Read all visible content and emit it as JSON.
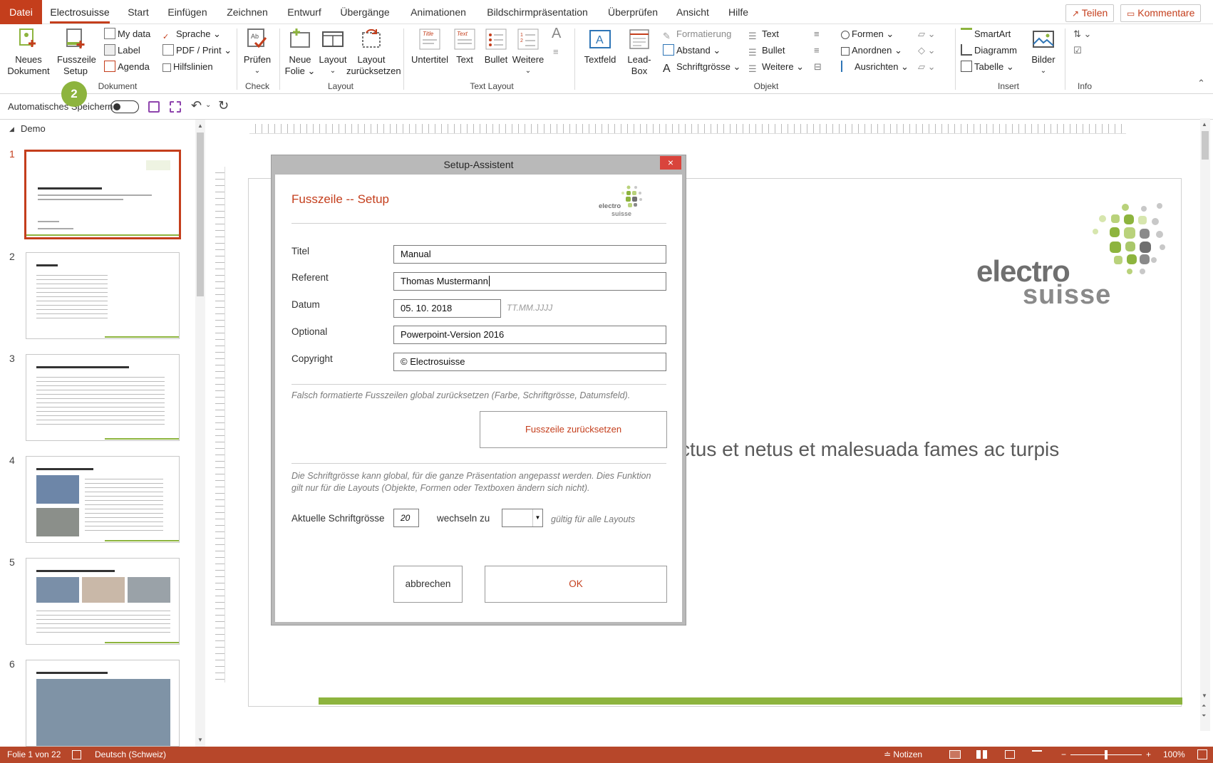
{
  "menu": {
    "tabs": [
      "Datei",
      "Electrosuisse",
      "Start",
      "Einfügen",
      "Zeichnen",
      "Entwurf",
      "Übergänge",
      "Animationen",
      "Bildschirmpräsentation",
      "Überprüfen",
      "Ansicht",
      "Hilfe"
    ],
    "share": "Teilen",
    "comments": "Kommentare"
  },
  "ribbon": {
    "neues_dokument": [
      "Neues",
      "Dokument"
    ],
    "fusszeile_setup": [
      "Fusszeile",
      "Setup"
    ],
    "my_data": "My data",
    "label": "Label",
    "agenda": "Agenda",
    "sprache": "Sprache",
    "pdf_print": "PDF / Print",
    "hilfslinien": "Hilfslinien",
    "pruefen": "Prüfen",
    "neue_folie": [
      "Neue",
      "Folie"
    ],
    "layout": "Layout",
    "layout_reset": [
      "Layout",
      "zurücksetzen"
    ],
    "untertitel": "Untertitel",
    "text": "Text",
    "bullet": "Bullet",
    "weitere": "Weitere",
    "textfeld": "Textfeld",
    "leadbox": [
      "Lead-",
      "Box"
    ],
    "formatierung": "Formatierung",
    "abstand": "Abstand",
    "schriftgroesse": "Schriftgrösse",
    "obj_text": "Text",
    "obj_bullet": "Bullet",
    "obj_weitere": "Weitere",
    "formen": "Formen",
    "anordnen": "Anordnen",
    "ausrichten": "Ausrichten",
    "smartart": "SmartArt",
    "diagramm": "Diagramm",
    "tabelle": "Tabelle",
    "bilder": "Bilder",
    "groups": {
      "dokument": "Dokument",
      "check": "Check",
      "layout": "Layout",
      "textlayout": "Text Layout",
      "objekt": "Objekt",
      "insert": "Insert",
      "info": "Info"
    }
  },
  "qat": {
    "autosave": "Automatisches Speichern",
    "badge": "2"
  },
  "thumbs": {
    "section": "Demo",
    "numbers": [
      "1",
      "2",
      "3",
      "4",
      "5",
      "6"
    ]
  },
  "slide": {
    "logo_line1": "electro",
    "logo_line2": "suisse",
    "text": "ctus et netus et malesuada fames ac turpis"
  },
  "dialog": {
    "title": "Setup-Assistent",
    "close": "×",
    "heading": "Fusszeile -- Setup",
    "logo_line1": "electro",
    "logo_line2": "suisse",
    "fields": {
      "titel_label": "Titel",
      "titel_value": "Manual",
      "referent_label": "Referent",
      "referent_value": "Thomas Mustermann",
      "datum_label": "Datum",
      "datum_value": "05. 10. 2018",
      "datum_hint": "TT.MM.JJJJ",
      "optional_label": "Optional",
      "optional_value": "Powerpoint-Version 2016",
      "copyright_label": "Copyright",
      "copyright_value": "© Electrosuisse"
    },
    "reset_note": "Falsch formatierte Fusszeilen global zurücksetzen (Farbe, Schriftgrösse, Datumsfeld).",
    "reset_button": "Fusszeile zurücksetzen",
    "font_note_1": "Die Schriftgrösse kann global, für die ganze Präsentation angepasst werden. Dies Funktion",
    "font_note_2": "gilt nur für die Layouts (Objekte, Formen oder Textboxen ändern sich nicht).",
    "font_current_label": "Aktuelle Schriftgrösse",
    "font_current_value": "20",
    "font_change_label": "wechseln zu",
    "font_scope": "gültig für alle Layouts",
    "cancel": "abbrechen",
    "ok": "OK"
  },
  "status": {
    "slide": "Folie 1 von 22",
    "language": "Deutsch (Schweiz)",
    "notes": "Notizen",
    "zoom": "100%"
  },
  "colors": {
    "accent": "#c43e1c",
    "status": "#b7472a",
    "green": "#8db43e"
  }
}
